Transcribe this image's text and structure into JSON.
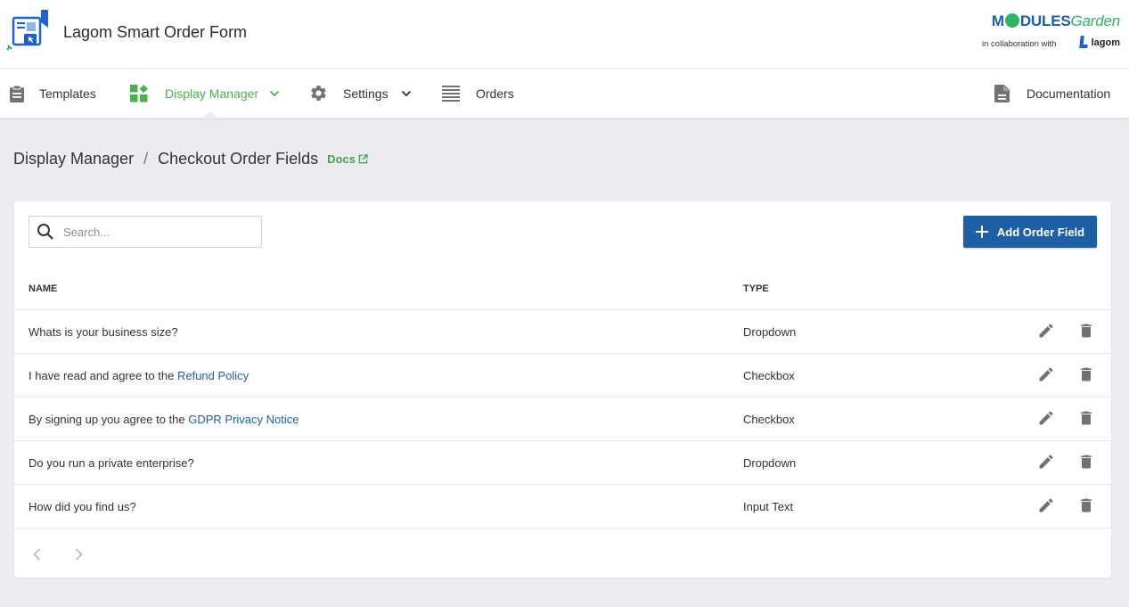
{
  "app": {
    "title": "Lagom Smart Order Form"
  },
  "brand": {
    "name_part1": "M",
    "name_part2": "DULES",
    "name_part3": "Garden",
    "collab": "in collaboration with",
    "partner": "lagom"
  },
  "nav": {
    "items": [
      {
        "label": "Templates",
        "icon": "clipboard-icon",
        "dropdown": false,
        "active": false
      },
      {
        "label": "Display Manager",
        "icon": "widgets-icon",
        "dropdown": true,
        "active": true
      },
      {
        "label": "Settings",
        "icon": "gear-icon",
        "dropdown": true,
        "active": false
      },
      {
        "label": "Orders",
        "icon": "list-icon",
        "dropdown": false,
        "active": false
      }
    ],
    "documentation": {
      "label": "Documentation",
      "icon": "document-icon"
    }
  },
  "breadcrumb": {
    "parent": "Display Manager",
    "separator": "/",
    "current": "Checkout Order Fields",
    "docs_label": "Docs"
  },
  "search": {
    "placeholder": "Search..."
  },
  "toolbar": {
    "add_label": "Add Order Field"
  },
  "table": {
    "columns": [
      "NAME",
      "TYPE"
    ],
    "rows": [
      {
        "name": "Whats is your business size?",
        "link": "",
        "type": "Dropdown"
      },
      {
        "name": "I have read and agree to the ",
        "link": "Refund Policy",
        "type": "Checkbox"
      },
      {
        "name": "By signing up you agree to the ",
        "link": "GDPR Privacy Notice",
        "type": "Checkbox"
      },
      {
        "name": "Do you run a private enterprise?",
        "link": "",
        "type": "Dropdown"
      },
      {
        "name": "How did you find us?",
        "link": "",
        "type": "Input Text"
      }
    ]
  },
  "colors": {
    "accent_green": "#4caf50",
    "primary_blue": "#1f5fa6",
    "icon_gray": "#6f7378",
    "background": "#ebedf2"
  }
}
